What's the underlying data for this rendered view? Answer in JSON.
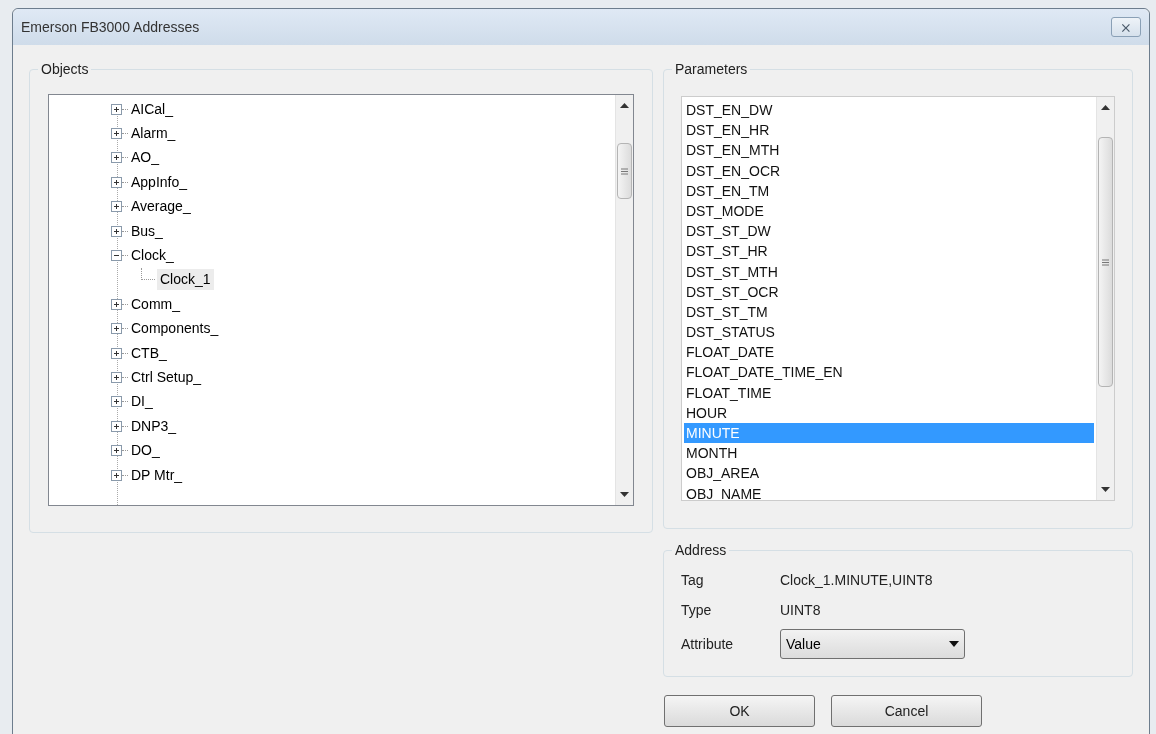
{
  "window": {
    "title": "Emerson FB3000 Addresses",
    "close_label": "⨯"
  },
  "objects": {
    "title": "Objects",
    "tree": [
      {
        "label": "AICal_",
        "expanded": false,
        "selected": false
      },
      {
        "label": "Alarm_",
        "expanded": false,
        "selected": false
      },
      {
        "label": "AO_",
        "expanded": false,
        "selected": false
      },
      {
        "label": "AppInfo_",
        "expanded": false,
        "selected": false
      },
      {
        "label": "Average_",
        "expanded": false,
        "selected": false
      },
      {
        "label": "Bus_",
        "expanded": false,
        "selected": false
      },
      {
        "label": "Clock_",
        "expanded": true,
        "selected": false,
        "children": [
          {
            "label": "Clock_1",
            "selected": true
          }
        ]
      },
      {
        "label": "Comm_",
        "expanded": false,
        "selected": false
      },
      {
        "label": "Components_",
        "expanded": false,
        "selected": false
      },
      {
        "label": "CTB_",
        "expanded": false,
        "selected": false
      },
      {
        "label": "Ctrl Setup_",
        "expanded": false,
        "selected": false
      },
      {
        "label": "DI_",
        "expanded": false,
        "selected": false
      },
      {
        "label": "DNP3_",
        "expanded": false,
        "selected": false
      },
      {
        "label": "DO_",
        "expanded": false,
        "selected": false
      },
      {
        "label": "DP Mtr_",
        "expanded": false,
        "selected": false
      }
    ]
  },
  "parameters": {
    "title": "Parameters",
    "items": [
      {
        "label": "DST_EN_DW",
        "selected": false
      },
      {
        "label": "DST_EN_HR",
        "selected": false
      },
      {
        "label": "DST_EN_MTH",
        "selected": false
      },
      {
        "label": "DST_EN_OCR",
        "selected": false
      },
      {
        "label": "DST_EN_TM",
        "selected": false
      },
      {
        "label": "DST_MODE",
        "selected": false
      },
      {
        "label": "DST_ST_DW",
        "selected": false
      },
      {
        "label": "DST_ST_HR",
        "selected": false
      },
      {
        "label": "DST_ST_MTH",
        "selected": false
      },
      {
        "label": "DST_ST_OCR",
        "selected": false
      },
      {
        "label": "DST_ST_TM",
        "selected": false
      },
      {
        "label": "DST_STATUS",
        "selected": false
      },
      {
        "label": "FLOAT_DATE",
        "selected": false
      },
      {
        "label": "FLOAT_DATE_TIME_EN",
        "selected": false
      },
      {
        "label": "FLOAT_TIME",
        "selected": false
      },
      {
        "label": "HOUR",
        "selected": false
      },
      {
        "label": "MINUTE",
        "selected": true
      },
      {
        "label": "MONTH",
        "selected": false
      },
      {
        "label": "OBJ_AREA",
        "selected": false
      },
      {
        "label": "OBJ_NAME",
        "selected": false
      }
    ]
  },
  "address": {
    "title": "Address",
    "fields": [
      {
        "kind": "text",
        "label": "Tag",
        "value": "Clock_1.MINUTE,UINT8"
      },
      {
        "kind": "text",
        "label": "Type",
        "value": "UINT8"
      },
      {
        "kind": "dropdown",
        "label": "Attribute",
        "value": "Value"
      }
    ]
  },
  "buttons": [
    "OK",
    "Cancel"
  ]
}
